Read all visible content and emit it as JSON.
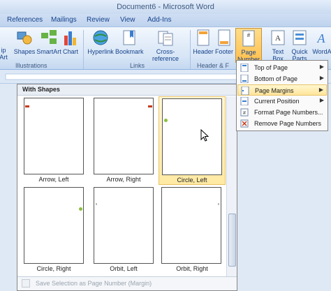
{
  "window": {
    "title": "Document6 - Microsoft Word"
  },
  "ribbon_tabs": [
    "References",
    "Mailings",
    "Review",
    "View",
    "Add-Ins"
  ],
  "ribbon": {
    "buttons": {
      "clipart": "ip\nArt",
      "shapes": "Shapes",
      "smartart": "SmartArt",
      "chart": "Chart",
      "hyperlink": "Hyperlink",
      "bookmark": "Bookmark",
      "crossref": "Cross-reference",
      "header": "Header",
      "footer": "Footer",
      "pagenumber": "Page\nNumber",
      "textbox": "Text\nBox",
      "quickparts": "Quick\nParts",
      "wordart": "WordA"
    },
    "groups": {
      "illustrations": "Illustrations",
      "links": "Links",
      "headerfooter": "Header & F"
    }
  },
  "gallery": {
    "header": "With Shapes",
    "items": [
      {
        "caption": "Arrow, Left"
      },
      {
        "caption": "Arrow, Right"
      },
      {
        "caption": "Circle, Left"
      },
      {
        "caption": "Circle, Right"
      },
      {
        "caption": "Orbit, Left"
      },
      {
        "caption": "Orbit, Right"
      }
    ],
    "footer": "Save Selection as Page Number (Margin)"
  },
  "menu": {
    "items": [
      {
        "label": "Top of Page",
        "accel": "T",
        "has_submenu": true
      },
      {
        "label": "Bottom of Page",
        "accel": "B",
        "has_submenu": true
      },
      {
        "label": "Page Margins",
        "accel": "P",
        "has_submenu": true
      },
      {
        "label": "Current Position",
        "accel": "C",
        "has_submenu": true
      },
      {
        "label": "Format Page Numbers...",
        "accel": "F",
        "has_submenu": false
      },
      {
        "label": "Remove Page Numbers",
        "accel": "R",
        "has_submenu": false
      }
    ]
  },
  "colors": {
    "accent": "#15428b",
    "highlight": "#ffe59a",
    "marker_green": "#8cbf3f",
    "marker_red": "#c63b1f"
  }
}
